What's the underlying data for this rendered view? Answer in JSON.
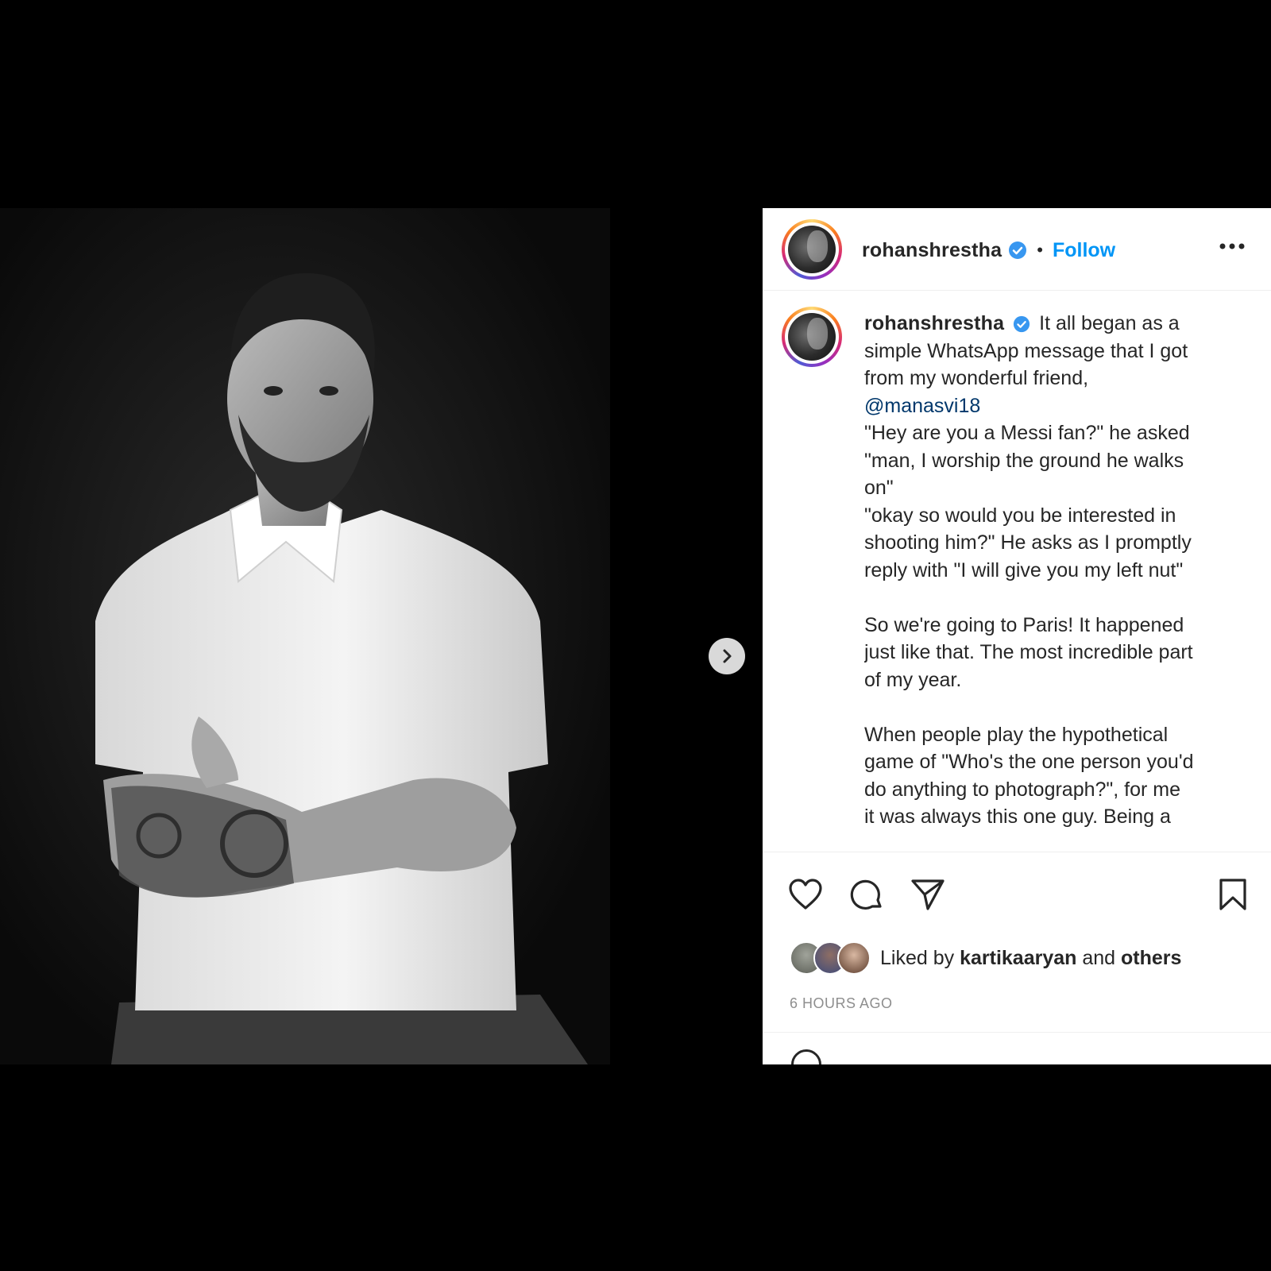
{
  "post": {
    "username": "rohanshrestha",
    "separator": "•",
    "follow_label": "Follow",
    "more_icon": "more-options-icon",
    "next_icon": "chevron-right-icon",
    "caption": {
      "username": "rohanshrestha",
      "line_1_rest": "It all began as a",
      "line_2": "simple WhatsApp message that I got",
      "line_3": "from my wonderful friend,",
      "mention": "@manasvi18",
      "line_5": "\"Hey are you a Messi fan?\" he asked",
      "line_6": "\"man, I worship the ground he walks",
      "line_7": "on\"",
      "line_8": "\"okay so would you be interested in",
      "line_9": "shooting him?\" He asks as I promptly",
      "line_10": "reply with \"I will give you my left nut\"",
      "line_11": "So we're going to Paris! It happened",
      "line_12": "just like that. The most incredible part",
      "line_13": "of my year.",
      "line_14": "When people play the hypothetical",
      "line_15": "game of \"Who's the one person you'd",
      "line_16": "do anything to photograph?\", for me",
      "line_17": "it was always this one guy. Being a"
    },
    "actions": {
      "like_icon": "heart-icon",
      "comment_icon": "comment-icon",
      "share_icon": "share-icon",
      "save_icon": "bookmark-icon"
    },
    "likes": {
      "prefix": "Liked by",
      "user": "kartikaaryan",
      "and": "and",
      "others": "others"
    },
    "timestamp": "6 HOURS AGO"
  },
  "colors": {
    "accent": "#0095f6",
    "text": "#262626",
    "muted": "#8e8e8e",
    "verified": "#3897f0"
  }
}
